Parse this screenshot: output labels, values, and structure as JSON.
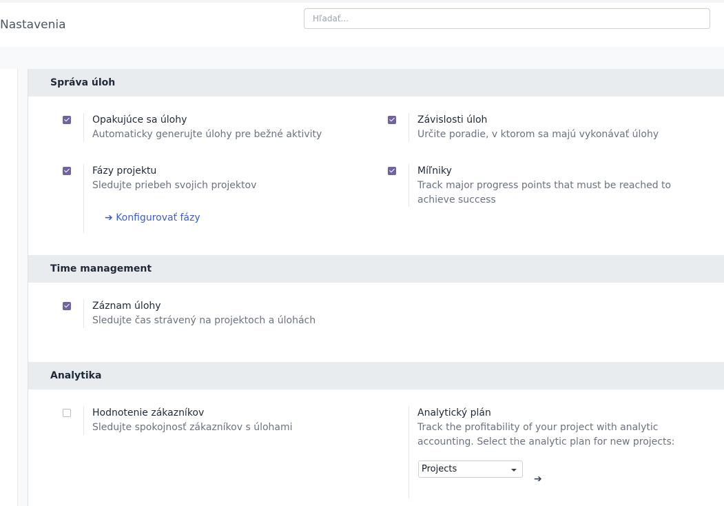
{
  "header": {
    "title": "Nastavenia",
    "search_placeholder": "Hľadať..."
  },
  "sections": {
    "task_management": {
      "title": "Správa úloh",
      "recurring": {
        "checked": true,
        "label": "Opakujúce sa úlohy",
        "description": "Automaticky generujte úlohy pre bežné aktivity"
      },
      "dependencies": {
        "checked": true,
        "label": "Závislosti úloh",
        "description": "Určite poradie, v ktorom sa majú vykonávať úlohy"
      },
      "stages": {
        "checked": true,
        "label": "Fázy projektu",
        "description": "Sledujte priebeh svojich projektov",
        "link_icon": "arrow-right-icon",
        "link": "Konfigurovať fázy"
      },
      "milestones": {
        "checked": true,
        "label": "Míľniky",
        "description": "Track major progress points that must be reached to achieve success"
      }
    },
    "time_management": {
      "title": "Time management",
      "timesheets": {
        "checked": true,
        "label": "Záznam úlohy",
        "description": "Sledujte čas strávený na projektoch a úlohách"
      }
    },
    "analytics": {
      "title": "Analytika",
      "ratings": {
        "checked": false,
        "label": "Hodnotenie zákazníkov",
        "description": "Sledujte spokojnosť zákazníkov s úlohami"
      },
      "analytic_plan": {
        "label": "Analytický plán",
        "description": "Track the profitability of your project with analytic accounting. Select the analytic plan for new projects:",
        "selected": "Projects",
        "button_icon": "arrow-right-icon"
      }
    }
  },
  "colors": {
    "accent": "#71639e",
    "link": "#3b5bdb",
    "section_header_bg": "#e9ecef"
  }
}
